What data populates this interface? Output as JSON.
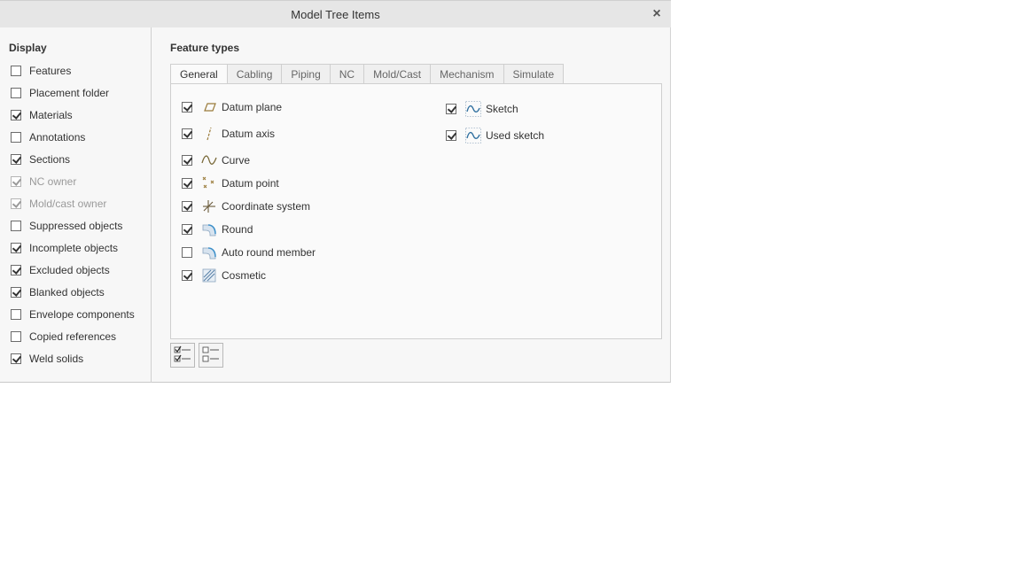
{
  "window": {
    "title": "Model Tree Items",
    "close_glyph": "×"
  },
  "display": {
    "title": "Display",
    "items": [
      {
        "label": "Features",
        "checked": false,
        "disabled": false
      },
      {
        "label": "Placement folder",
        "checked": false,
        "disabled": false
      },
      {
        "label": "Materials",
        "checked": true,
        "disabled": false
      },
      {
        "label": "Annotations",
        "checked": false,
        "disabled": false
      },
      {
        "label": "Sections",
        "checked": true,
        "disabled": false
      },
      {
        "label": "NC owner",
        "checked": true,
        "disabled": true
      },
      {
        "label": "Mold/cast owner",
        "checked": true,
        "disabled": true
      },
      {
        "label": "Suppressed objects",
        "checked": false,
        "disabled": false
      },
      {
        "label": "Incomplete objects",
        "checked": true,
        "disabled": false
      },
      {
        "label": "Excluded objects",
        "checked": true,
        "disabled": false
      },
      {
        "label": "Blanked objects",
        "checked": true,
        "disabled": false
      },
      {
        "label": "Envelope components",
        "checked": false,
        "disabled": false
      },
      {
        "label": "Copied references",
        "checked": false,
        "disabled": false
      },
      {
        "label": "Weld solids",
        "checked": true,
        "disabled": false
      }
    ]
  },
  "feature_types": {
    "title": "Feature types",
    "tabs": [
      {
        "label": "General",
        "active": true
      },
      {
        "label": "Cabling",
        "active": false
      },
      {
        "label": "Piping",
        "active": false
      },
      {
        "label": "NC",
        "active": false
      },
      {
        "label": "Mold/Cast",
        "active": false
      },
      {
        "label": "Mechanism",
        "active": false
      },
      {
        "label": "Simulate",
        "active": false
      }
    ],
    "left_items": [
      {
        "label": "Datum plane",
        "checked": true,
        "icon": "datum-plane-icon"
      },
      {
        "label": "Datum axis",
        "checked": true,
        "icon": "datum-axis-icon"
      },
      {
        "label": "Curve",
        "checked": true,
        "icon": "curve-icon"
      },
      {
        "label": "Datum point",
        "checked": true,
        "icon": "datum-point-icon"
      },
      {
        "label": "Coordinate system",
        "checked": true,
        "icon": "coordinate-system-icon"
      },
      {
        "label": "Round",
        "checked": true,
        "icon": "round-icon"
      },
      {
        "label": "Auto round member",
        "checked": false,
        "icon": "auto-round-member-icon"
      },
      {
        "label": "Cosmetic",
        "checked": true,
        "icon": "cosmetic-icon"
      }
    ],
    "right_items": [
      {
        "label": "Sketch",
        "checked": true,
        "icon": "sketch-icon"
      },
      {
        "label": "Used sketch",
        "checked": true,
        "icon": "used-sketch-icon"
      }
    ]
  },
  "buttons": {
    "select_all": {
      "icon": "select-all-icon"
    },
    "clear_all": {
      "icon": "clear-all-icon"
    }
  },
  "colors": {
    "titlebar": "#e6e6e6",
    "dialog_bg": "#f7f7f7",
    "panel_bg": "#fafafa",
    "text": "#333333",
    "disabled_text": "#9a9a9a",
    "icon_tan": "#9a7b3a",
    "icon_blue": "#3b8fc9"
  }
}
